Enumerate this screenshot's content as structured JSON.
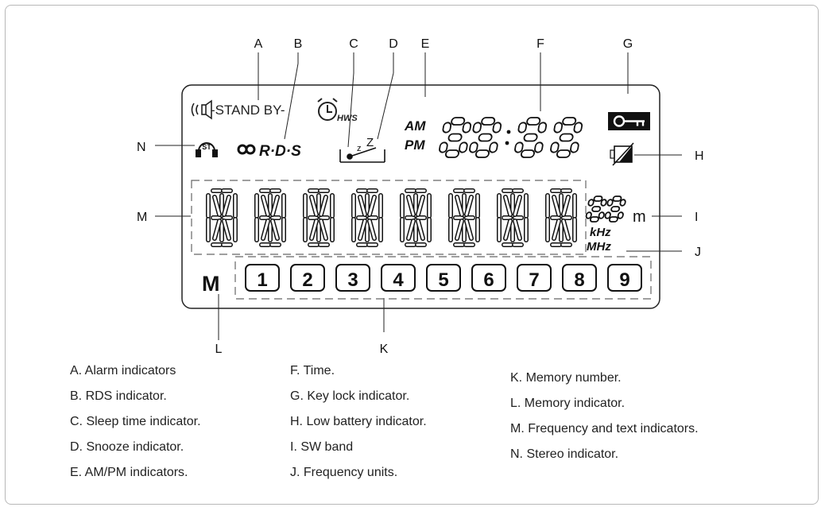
{
  "callout_letters": [
    "A",
    "B",
    "C",
    "D",
    "E",
    "F",
    "G",
    "H",
    "I",
    "J",
    "K",
    "L",
    "M",
    "N"
  ],
  "display": {
    "standby_text": "-STAND BY-",
    "hws_text": "HWS",
    "st_text": "ST",
    "rds_text": "R·D·S",
    "am_text": "AM",
    "pm_text": "PM",
    "snooze_z_small": "z",
    "snooze_z_big": "Z",
    "m_unit": "m",
    "khz_text": "kHz",
    "mhz_text": "MHz",
    "memory_letter": "M",
    "memory_numbers": [
      "1",
      "2",
      "3",
      "4",
      "5",
      "6",
      "7",
      "8",
      "9"
    ]
  },
  "legend": [
    [
      "A. Alarm indicators",
      "B. RDS indicator.",
      "C. Sleep time indicator.",
      "D. Snooze indicator.",
      "E. AM/PM indicators."
    ],
    [
      "F. Time.",
      "G. Key lock indicator.",
      "H. Low battery indicator.",
      " I. SW band",
      "J.  Frequency units."
    ],
    [
      "K. Memory number.",
      "L. Memory indicator.",
      "M. Frequency and text indicators.",
      "N. Stereo indicator."
    ]
  ]
}
